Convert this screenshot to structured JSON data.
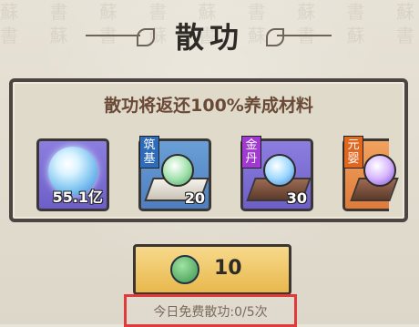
{
  "title": "散功",
  "panel": {
    "heading": "散功将返还100%养成材料",
    "items": [
      {
        "tag": "",
        "quantity": "55.1亿",
        "icon": "spirit-orb-icon"
      },
      {
        "tag": "筑基",
        "quantity": "20",
        "icon": "green-pill-on-stand-icon"
      },
      {
        "tag": "金丹",
        "quantity": "30",
        "icon": "blue-orb-on-stand-icon"
      },
      {
        "tag": "元婴",
        "quantity": "",
        "icon": "violet-orb-on-stand-icon"
      }
    ]
  },
  "cost_button": {
    "amount": "10",
    "icon": "jade-coin-icon"
  },
  "free_count_label": "今日免费散功:0/5次",
  "colors": {
    "accent_red_outline": "#e03a3a",
    "button_gold": "#e8b84c",
    "tag_blue": "#2f6bb8",
    "tag_purple": "#a13bd0",
    "tag_orange": "#e0671f"
  }
}
